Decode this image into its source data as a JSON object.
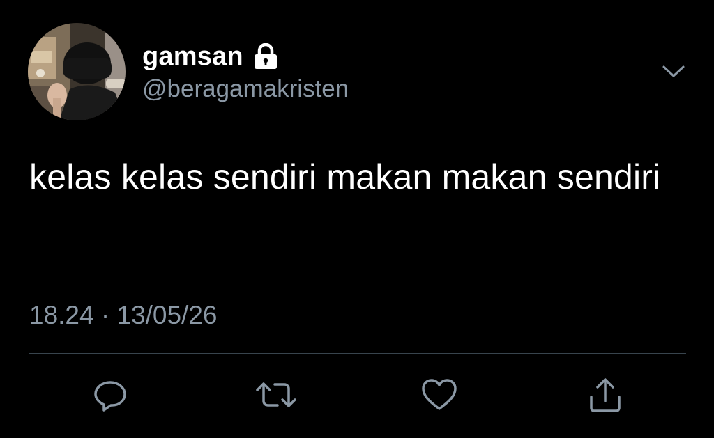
{
  "user": {
    "display_name": "gamsan",
    "handle": "@beragamakristen",
    "protected_icon": "lock-icon",
    "avatar": "avatar-photo"
  },
  "menu": {
    "icon": "chevron-down-icon"
  },
  "tweet": {
    "text": "kelas kelas sendiri makan makan sendiri",
    "timestamp": "18.24 · 13/05/26"
  },
  "actions": [
    {
      "icon": "reply-icon"
    },
    {
      "icon": "retweet-icon"
    },
    {
      "icon": "like-icon"
    },
    {
      "icon": "share-icon"
    }
  ],
  "colors": {
    "background": "#000000",
    "primary_text": "#ffffff",
    "secondary_text": "#8b98a5",
    "divider": "#38444d"
  }
}
